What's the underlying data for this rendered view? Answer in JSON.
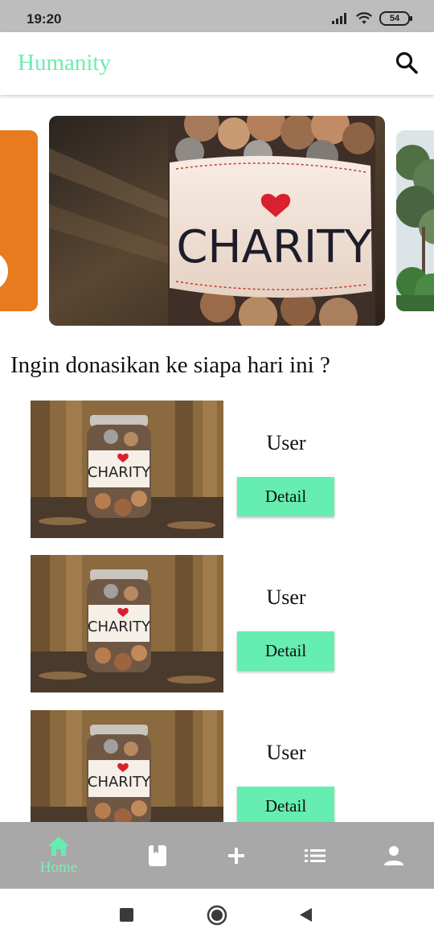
{
  "status_bar": {
    "time": "19:20",
    "battery_level": "54"
  },
  "app_bar": {
    "title": "Humanity",
    "search_icon": "search-icon"
  },
  "carousel": {
    "main_label": "CHARITY"
  },
  "section": {
    "title": "Ingin donasikan ke siapa hari ini ?"
  },
  "items": [
    {
      "name": "User",
      "button_label": "Detail",
      "image_label": "CHARITY"
    },
    {
      "name": "User",
      "button_label": "Detail",
      "image_label": "CHARITY"
    },
    {
      "name": "User",
      "button_label": "Detail",
      "image_label": "CHARITY"
    }
  ],
  "bottom_nav": {
    "items": [
      {
        "icon": "home-icon",
        "label": "Home",
        "active": true
      },
      {
        "icon": "book-icon",
        "label": ""
      },
      {
        "icon": "plus-icon",
        "label": ""
      },
      {
        "icon": "list-icon",
        "label": ""
      },
      {
        "icon": "person-icon",
        "label": ""
      }
    ]
  },
  "colors": {
    "accent": "#66edb0",
    "app_title": "#6cecb1",
    "nav_background": "#a8a8a8",
    "orange_card": "#e87a1f"
  }
}
